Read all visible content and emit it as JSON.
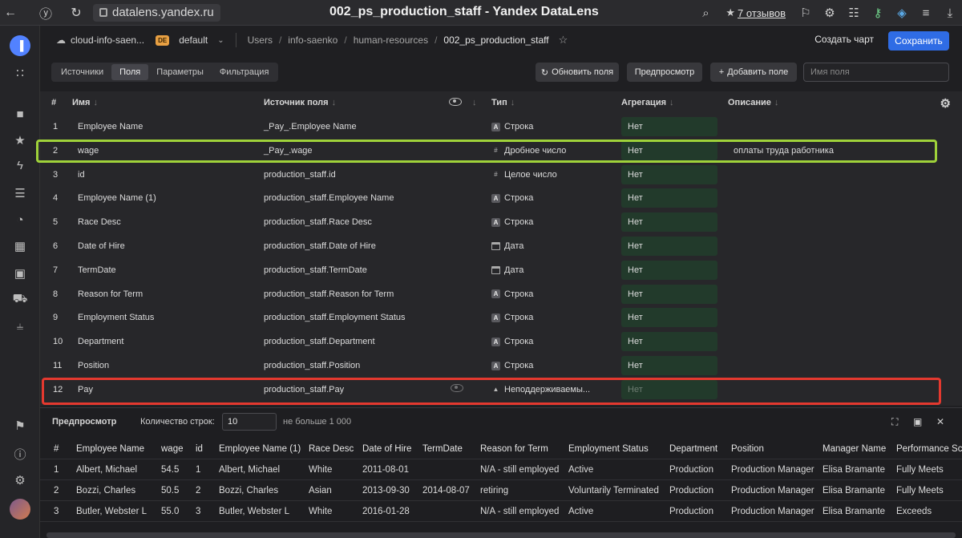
{
  "browser": {
    "url": "datalens.yandex.ru",
    "title": "002_ps_production_staff - Yandex DataLens",
    "reviews": "7 отзывов"
  },
  "header": {
    "cloud": "cloud-info-saen...",
    "cloud_badge": "DE",
    "folder": "default",
    "breadcrumbs": [
      "Users",
      "info-saenko",
      "human-resources",
      "002_ps_production_staff"
    ],
    "create_chart": "Создать чарт",
    "save": "Сохранить"
  },
  "toolbar": {
    "tabs": [
      "Источники",
      "Поля",
      "Параметры",
      "Фильтрация"
    ],
    "refresh": "Обновить поля",
    "preview": "Предпросмотр",
    "add_field": "Добавить поле",
    "search_placeholder": "Имя поля"
  },
  "fields": {
    "headers": {
      "num": "#",
      "name": "Имя",
      "source": "Источник поля",
      "type": "Тип",
      "aggregation": "Агрегация",
      "description": "Описание"
    },
    "rows": [
      {
        "num": "1",
        "name": "Employee Name",
        "source": "_Pay_.Employee Name",
        "type": "Строка",
        "type_icon": "string-icon",
        "agg": "Нет",
        "desc": ""
      },
      {
        "num": "2",
        "name": "wage",
        "source": "_Pay_.wage",
        "type": "Дробное число",
        "type_icon": "number-icon",
        "agg": "Нет",
        "desc": "оплаты труда работника"
      },
      {
        "num": "3",
        "name": "id",
        "source": "production_staff.id",
        "type": "Целое число",
        "type_icon": "number-icon",
        "agg": "Нет",
        "desc": ""
      },
      {
        "num": "4",
        "name": "Employee Name (1)",
        "source": "production_staff.Employee Name",
        "type": "Строка",
        "type_icon": "string-icon",
        "agg": "Нет",
        "desc": ""
      },
      {
        "num": "5",
        "name": "Race Desc",
        "source": "production_staff.Race Desc",
        "type": "Строка",
        "type_icon": "string-icon",
        "agg": "Нет",
        "desc": ""
      },
      {
        "num": "6",
        "name": "Date of Hire",
        "source": "production_staff.Date of Hire",
        "type": "Дата",
        "type_icon": "calendar-icon",
        "agg": "Нет",
        "desc": ""
      },
      {
        "num": "7",
        "name": "TermDate",
        "source": "production_staff.TermDate",
        "type": "Дата",
        "type_icon": "calendar-icon",
        "agg": "Нет",
        "desc": ""
      },
      {
        "num": "8",
        "name": "Reason for Term",
        "source": "production_staff.Reason for Term",
        "type": "Строка",
        "type_icon": "string-icon",
        "agg": "Нет",
        "desc": ""
      },
      {
        "num": "9",
        "name": "Employment Status",
        "source": "production_staff.Employment Status",
        "type": "Строка",
        "type_icon": "string-icon",
        "agg": "Нет",
        "desc": ""
      },
      {
        "num": "10",
        "name": "Department",
        "source": "production_staff.Department",
        "type": "Строка",
        "type_icon": "string-icon",
        "agg": "Нет",
        "desc": ""
      },
      {
        "num": "11",
        "name": "Position",
        "source": "production_staff.Position",
        "type": "Строка",
        "type_icon": "string-icon",
        "agg": "Нет",
        "desc": ""
      },
      {
        "num": "12",
        "name": "Pay",
        "source": "production_staff.Pay",
        "type": "Неподдерживаемы...",
        "type_icon": "warning-icon",
        "agg": "Нет",
        "desc": ""
      }
    ]
  },
  "preview": {
    "title": "Предпросмотр",
    "row_count_label": "Количество строк:",
    "row_count": "10",
    "max_note": "не больше 1 000",
    "columns": [
      "#",
      "Employee Name",
      "wage",
      "id",
      "Employee Name (1)",
      "Race Desc",
      "Date of Hire",
      "TermDate",
      "Reason for Term",
      "Employment Status",
      "Department",
      "Position",
      "Manager Name",
      "Performance Sc"
    ],
    "rows": [
      [
        "1",
        "Albert, Michael",
        "54.5",
        "1",
        "Albert, Michael",
        "White",
        "2011-08-01",
        "",
        "N/A - still employed",
        "Active",
        "Production",
        "Production Manager",
        "Elisa Bramante",
        "Fully Meets"
      ],
      [
        "2",
        "Bozzi, Charles",
        "50.5",
        "2",
        "Bozzi, Charles",
        "Asian",
        "2013-09-30",
        "2014-08-07",
        "retiring",
        "Voluntarily Terminated",
        "Production",
        "Production Manager",
        "Elisa Bramante",
        "Fully Meets"
      ],
      [
        "3",
        "Butler, Webster L",
        "55.0",
        "3",
        "Butler, Webster L",
        "White",
        "2016-01-28",
        "",
        "N/A - still employed",
        "Active",
        "Production",
        "Production Manager",
        "Elisa Bramante",
        "Exceeds"
      ]
    ]
  }
}
